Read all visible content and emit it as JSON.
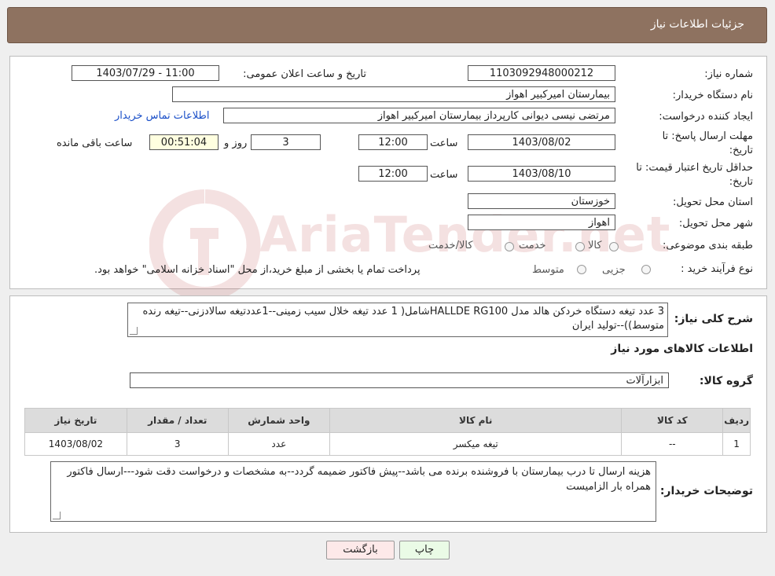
{
  "header": {
    "title": "جزئیات اطلاعات نیاز"
  },
  "watermark": {
    "text": "AriaTender.net",
    "color": "#b22222"
  },
  "fields": {
    "need_number_label": "شماره نیاز:",
    "need_number": "1103092948000212",
    "announce_label": "تاریخ و ساعت اعلان عمومی:",
    "announce_value": "1403/07/29 - 11:00",
    "buyer_org_label": "نام دستگاه خریدار:",
    "buyer_org": "بیمارستان امیرکبیر اهواز",
    "requester_label": "ایجاد کننده درخواست:",
    "requester": "مرتضی نیسی دیوانی کارپرداز بیمارستان امیرکبیر اهواز",
    "contact_link": "اطلاعات تماس خریدار",
    "deadline_label_1": "مهلت ارسال پاسخ: تا",
    "deadline_label_2": "تاریخ:",
    "deadline_date": "1403/08/02",
    "time_label": "ساعت",
    "deadline_time": "12:00",
    "days_value": "3",
    "days_label": "روز و",
    "remaining_time": "00:51:04",
    "remaining_label": "ساعت باقی مانده",
    "validity_label_1": "حداقل تاریخ اعتبار قیمت: تا",
    "validity_label_2": "تاریخ:",
    "validity_date": "1403/08/10",
    "validity_time": "12:00",
    "province_label": "استان محل تحویل:",
    "province": "خوزستان",
    "city_label": "شهر محل تحویل:",
    "city": "اهواز",
    "category_label": "طبقه بندی موضوعی:",
    "category_options": [
      "کالا",
      "خدمت",
      "کالا/خدمت"
    ],
    "process_label": "نوع فرآیند خرید :",
    "process_options": [
      "جزیی",
      "متوسط"
    ],
    "process_note": "پرداخت تمام یا بخشی از مبلغ خرید،از محل \"اسناد خزانه اسلامی\" خواهد بود."
  },
  "summary": {
    "label": "شرح کلی نیاز:",
    "text": "3 عدد تیغه دستگاه خردکن هالد مدل  HALLDE RG100شامل( 1 عدد تیغه خلال سیب زمینی--1عددتیغه سالادزنی--تیغه رنده متوسط))--تولید ایران",
    "goods_info_title": "اطلاعات کالاهای مورد نیاز",
    "group_label": "گروه کالا:",
    "group_value": "ابزارآلات"
  },
  "table": {
    "headers": [
      "ردیف",
      "کد کالا",
      "نام کالا",
      "واحد شمارش",
      "تعداد / مقدار",
      "تاریخ نیاز"
    ],
    "rows": [
      [
        "1",
        "--",
        "تیغه میکسر",
        "عدد",
        "3",
        "1403/08/02"
      ]
    ]
  },
  "buyer_notes": {
    "label": "توضیحات خریدار:",
    "text": "هزینه ارسال تا درب بیمارستان با فروشنده برنده می باشد--پیش فاکتور ضمیمه گردد--به مشخصات و درخواست دقت شود---ارسال فاکتور همراه بار الزامیست"
  },
  "buttons": {
    "print": "چاپ",
    "back": "بازگشت"
  },
  "colors": {
    "title_bar": "#8e7260",
    "print_bg": "#eafbe6",
    "back_bg": "#fde9e9",
    "link": "#1a4fc8"
  }
}
